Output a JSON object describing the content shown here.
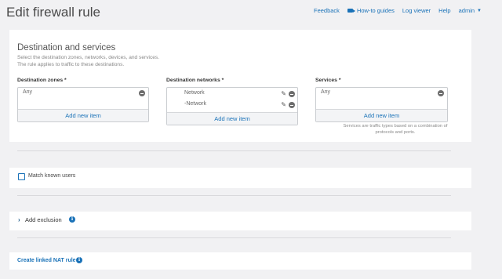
{
  "header": {
    "title": "Edit firewall rule",
    "links": {
      "feedback": "Feedback",
      "how_to": "How-to guides",
      "log_viewer": "Log viewer",
      "help": "Help",
      "admin": "admin"
    }
  },
  "destination": {
    "title": "Destination and services",
    "desc_line1": "Select the destination zones, networks, devices, and services.",
    "desc_line2": "The rule applies to traffic to these destinations.",
    "zones": {
      "label": "Destination zones *",
      "items": [
        "Any"
      ],
      "add_label": "Add new item"
    },
    "networks": {
      "label": "Destination networks *",
      "items": [
        "Network",
        "-Network"
      ],
      "add_label": "Add new item"
    },
    "services": {
      "label": "Services *",
      "items": [
        "Any"
      ],
      "add_label": "Add new item",
      "note": "Services are traffic types based on a combination of protocols and ports."
    }
  },
  "users": {
    "checkbox_label": "Match known users",
    "checked": false
  },
  "exclusion": {
    "label": "Add exclusion"
  },
  "nat": {
    "link_label": "Create linked NAT rule"
  },
  "colors": {
    "accent": "#1a72b8",
    "background": "#f1f1f3",
    "panel": "#ffffff"
  },
  "icons": [
    "camera-icon",
    "caret-down-icon",
    "minus-circle-icon",
    "pencil-icon",
    "chevron-right-icon",
    "info-icon"
  ]
}
